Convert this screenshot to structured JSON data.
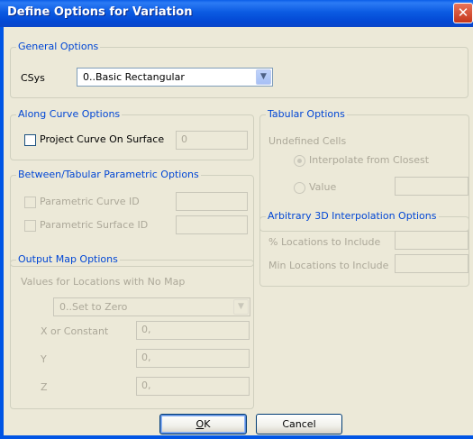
{
  "window": {
    "title": "Define Options for Variation",
    "close_glyph": "✕"
  },
  "general": {
    "legend": "General Options",
    "csys_label": "CSys",
    "csys_value": "0..Basic Rectangular"
  },
  "along_curve": {
    "legend": "Along Curve Options",
    "project_label": "Project Curve On Surface",
    "project_value": "0"
  },
  "between": {
    "legend": "Between/Tabular Parametric Options",
    "curve_id_label": "Parametric Curve ID",
    "surface_id_label": "Parametric Surface ID"
  },
  "output_map": {
    "legend": "Output Map Options",
    "no_map_label": "Values for Locations with No Map",
    "no_map_value": "0..Set to Zero",
    "x_label": "X or Constant",
    "x_value": "0,",
    "y_label": "Y",
    "y_value": "0,",
    "z_label": "Z",
    "z_value": "0,"
  },
  "tabular": {
    "legend": "Tabular Options",
    "undefined_label": "Undefined Cells",
    "interpolate_label": "Interpolate from Closest",
    "value_label": "Value"
  },
  "arbitrary": {
    "legend": "Arbitrary 3D Interpolation Options",
    "pct_label": "% Locations to Include",
    "min_label": "Min Locations to Include"
  },
  "buttons": {
    "ok_underlined": "O",
    "ok_rest": "K",
    "cancel": "Cancel"
  },
  "icons": {
    "dropdown": "chevron-down-icon",
    "close": "close-icon"
  },
  "colors": {
    "title_bar": "#0055e5",
    "group_label": "#0046d5",
    "disabled_text": "#aca899",
    "dialog_bg": "#ece9d8"
  }
}
